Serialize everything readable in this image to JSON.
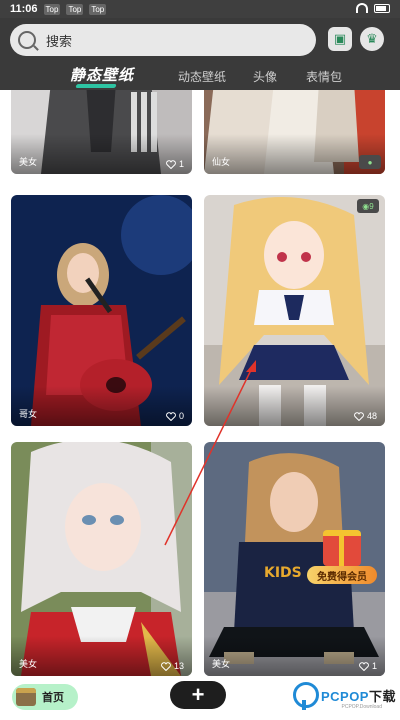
{
  "status_bar": {
    "time": "11:06",
    "notifications": [
      "Top",
      "Top",
      "Top"
    ]
  },
  "header": {
    "search_placeholder": "搜索",
    "icons": [
      "gift-card-icon",
      "gem-icon"
    ]
  },
  "tabs": [
    {
      "label": "静态壁纸",
      "active": true
    },
    {
      "label": "动态壁纸",
      "active": false
    },
    {
      "label": "头像",
      "active": false
    },
    {
      "label": "表情包",
      "active": false
    }
  ],
  "cards": [
    {
      "category": "美女",
      "likes": "1",
      "image": "girl-gray-cardigan-photo"
    },
    {
      "category": "仙女",
      "likes": "0",
      "image": "white-dress-photo"
    },
    {
      "category": "哥女",
      "likes": "0",
      "image": "singer-guitar-red-sequin-photo"
    },
    {
      "category": "",
      "likes": "48",
      "image": "anime-girl-school-uniform-photo"
    },
    {
      "category": "美女",
      "likes": "13",
      "image": "silver-hair-cosplay-photo"
    },
    {
      "category": "美女",
      "likes": "1",
      "image": "girl-sweater-sitting-photo"
    }
  ],
  "promo": {
    "label": "免费得会员",
    "icon": "red-gift-box-icon"
  },
  "bottom_nav": {
    "home_label": "首页",
    "add_label": "+"
  },
  "watermark": {
    "brand_blue": "PCPOP",
    "brand_dark": "下载",
    "sub": "PCPOP.Download"
  },
  "colors": {
    "header_bg": "#3a3a3a",
    "accent": "#2ec4a3",
    "home_pill": "#b6f1c9"
  }
}
